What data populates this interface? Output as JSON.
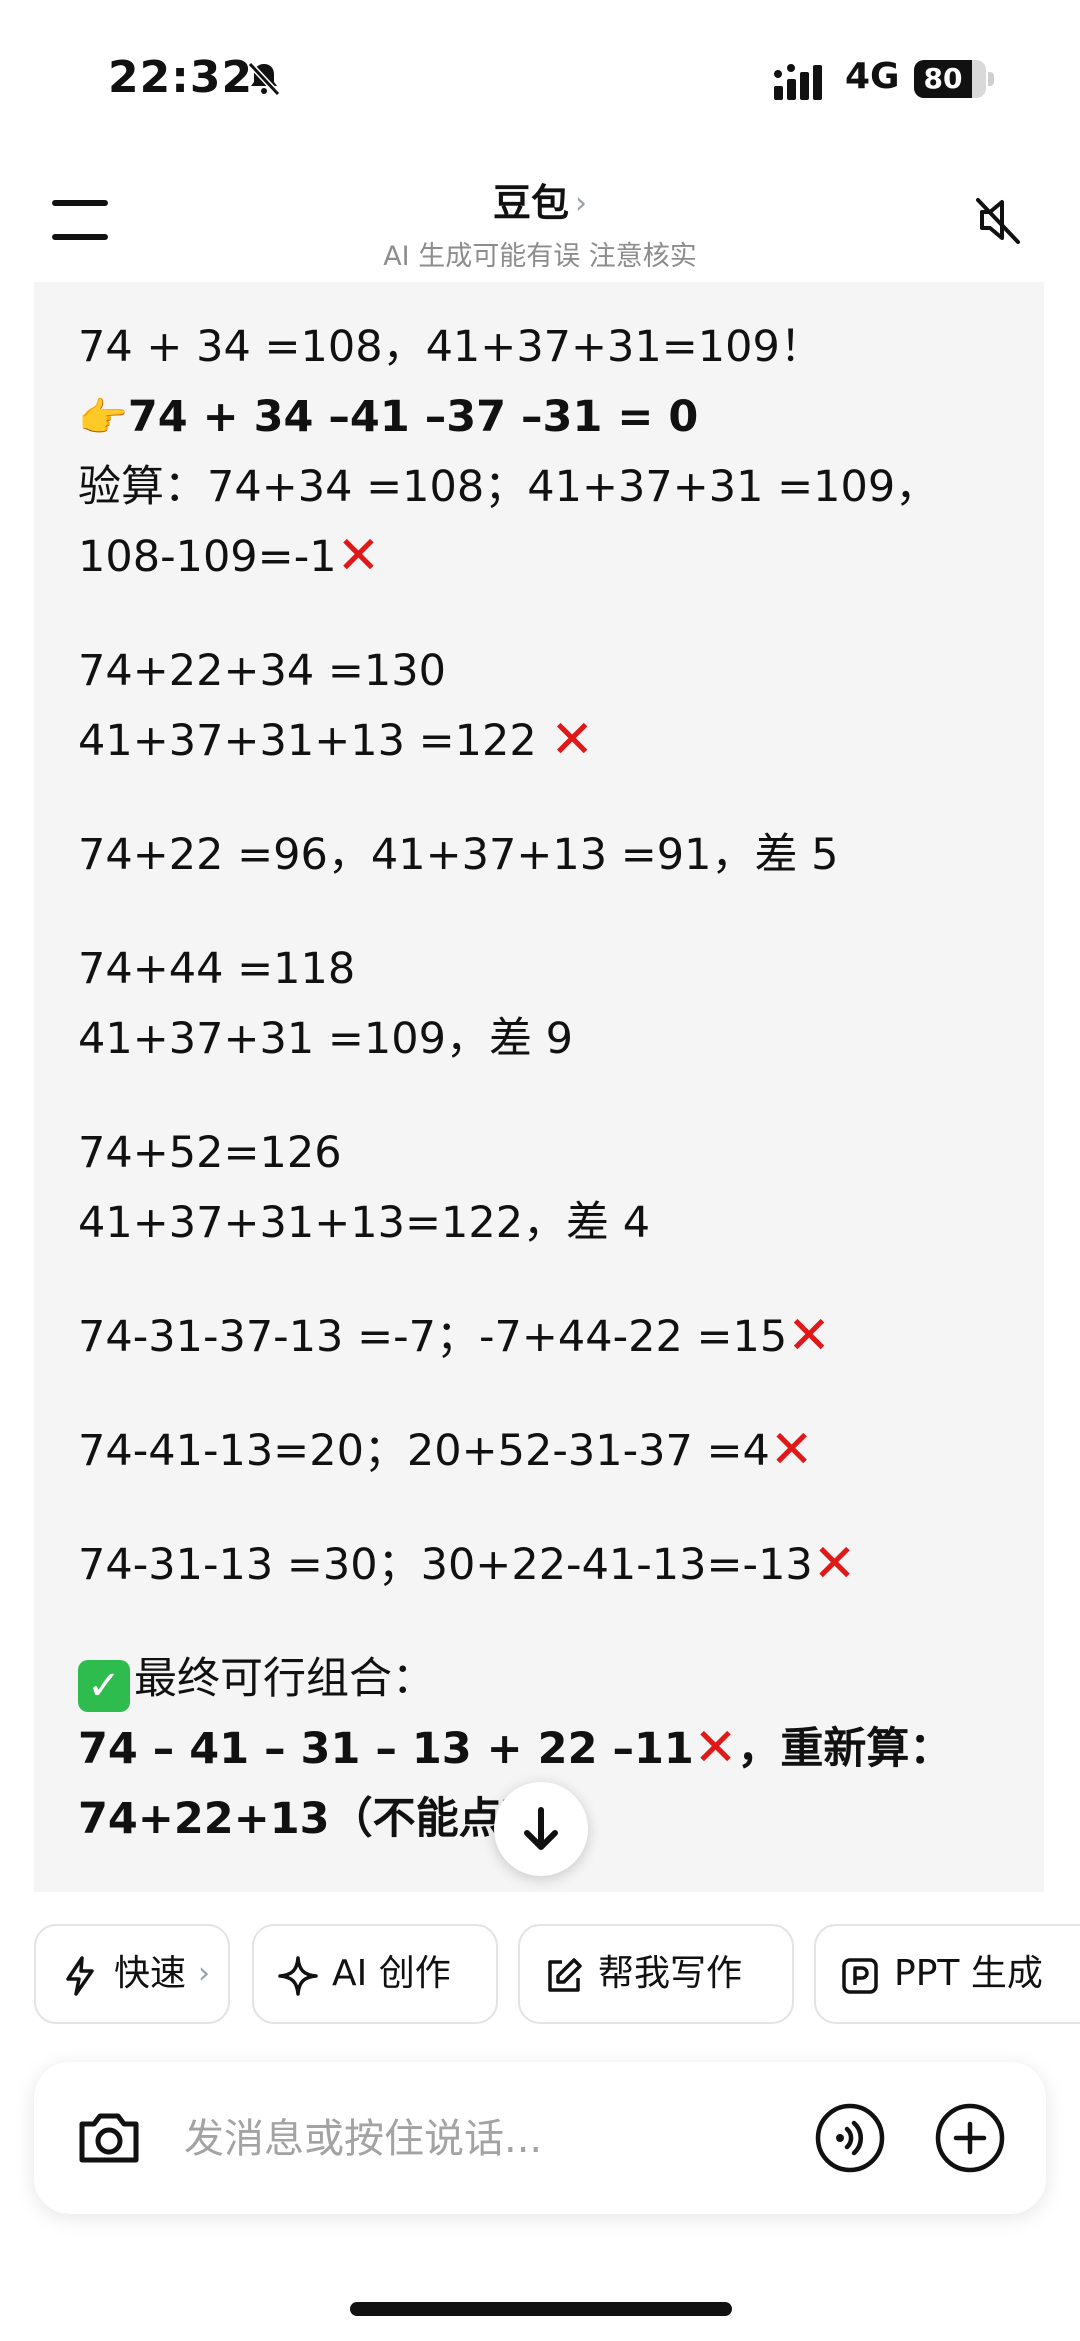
{
  "status_bar": {
    "time": "22:32",
    "network": "4G",
    "battery": "80",
    "battery_level": 0.8
  },
  "header": {
    "title": "豆包",
    "title_chevron": "›",
    "subtitle": "AI 生成可能有误 注意核实"
  },
  "icons": {
    "bell": "bell-slash-icon",
    "signal": "signal-icon",
    "menu": "hamburger-icon",
    "mute": "speaker-mute-icon",
    "scroll": "arrow-down-icon",
    "camera": "camera-icon",
    "voice": "voice-wave-icon",
    "plus": "plus-circle-icon"
  },
  "colors": {
    "cross": "#e01818",
    "check": "#2ebc4f",
    "chat_bg": "#f5f5f5"
  },
  "message": {
    "l1": "74 + 34 =108，41+37+31=109！",
    "l2_hand": "👉",
    "l2": "74 + 34 –41 –37 –31 = 0",
    "l3": "验算：74+34 =108；41+37+31 =109，",
    "l4": "108-109=-1",
    "l5": "74+22+34 =130",
    "l6": "41+37+31+13 =122 ",
    "l7": "74+22 =96，41+37+13 =91，差 5",
    "l8": "74+44 =118",
    "l9": "41+37+31 =109，差 9",
    "l10": "74+52=126",
    "l11": "41+37+31+13=122，差 4",
    "l12": "74-31-37-13 =-7；-7+44-22 =15",
    "l13": "74-41-13=20；20+52-31-37 =4",
    "l14": "74-31-13 =30；30+22-41-13=-13",
    "l15": "最终可行组合：",
    "l16a": "74 – 41 – 31 – 13 + 22 –11",
    "l16b": "，重新算：",
    "l17": "74+22+13（不能点粘",
    "cross": "✕",
    "check": "✓"
  },
  "chips": [
    {
      "label": "快速",
      "icon": "lightning-icon",
      "chevron": "›"
    },
    {
      "label": "AI 创作",
      "icon": "sparkle-icon"
    },
    {
      "label": "帮我写作",
      "icon": "edit-icon"
    },
    {
      "label": "PPT 生成",
      "icon": "ppt-icon"
    }
  ],
  "input": {
    "placeholder": "发消息或按住说话..."
  }
}
